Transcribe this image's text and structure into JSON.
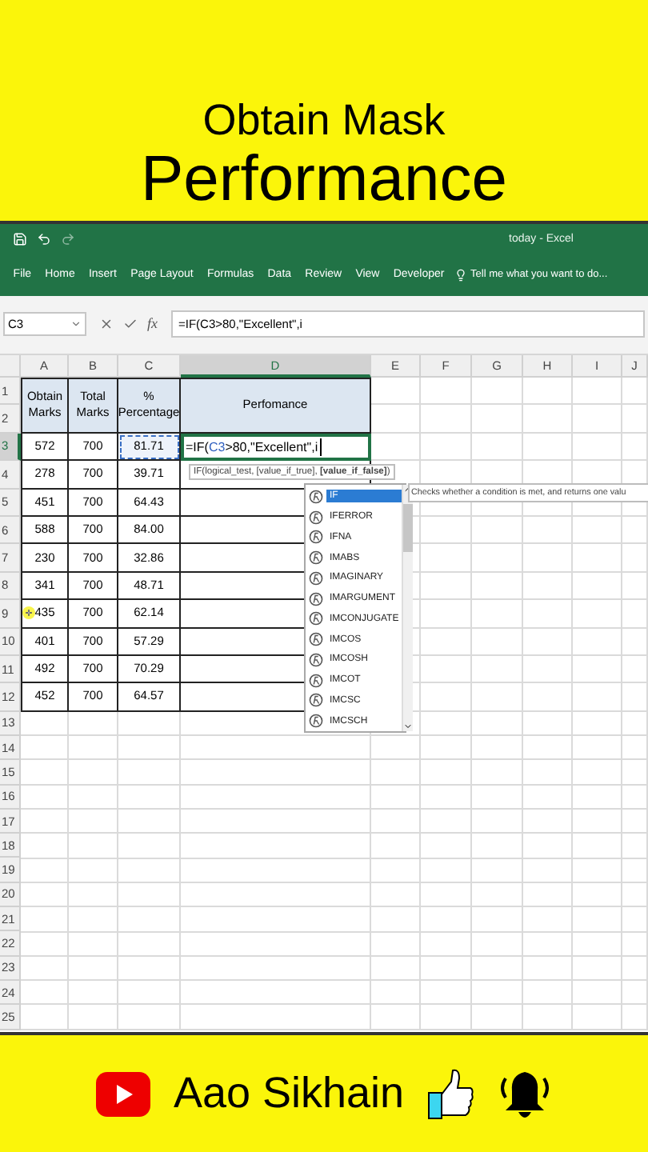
{
  "top_banner": {
    "title": "Obtain Mask",
    "subtitle": "Performance"
  },
  "excel": {
    "window_title": "today - Excel",
    "tabs": [
      {
        "label": "File",
        "selected": false
      },
      {
        "label": "Home",
        "selected": false
      },
      {
        "label": "Insert",
        "selected": false
      },
      {
        "label": "Page Layout",
        "selected": false
      },
      {
        "label": "Formulas",
        "selected": false
      },
      {
        "label": "Data",
        "selected": false
      },
      {
        "label": "Review",
        "selected": false
      },
      {
        "label": "View",
        "selected": false
      },
      {
        "label": "Developer",
        "selected": false
      }
    ],
    "tell_me": "Tell me what you want to do...",
    "name_box": "C3",
    "fx_label": "fx",
    "formula": "=IF(C3>80,\"Excellent\",i",
    "column_headers": [
      {
        "label": "A",
        "selected": false
      },
      {
        "label": "B",
        "selected": false
      },
      {
        "label": "C",
        "selected": false
      },
      {
        "label": "D",
        "selected": true
      },
      {
        "label": "E",
        "selected": false
      },
      {
        "label": "F",
        "selected": false
      },
      {
        "label": "G",
        "selected": false
      },
      {
        "label": "H",
        "selected": false
      },
      {
        "label": "I",
        "selected": false
      },
      {
        "label": "J",
        "selected": false
      }
    ],
    "row_numbers": [
      {
        "label": "1",
        "selected": false
      },
      {
        "label": "2",
        "selected": false
      },
      {
        "label": "3",
        "selected": true
      },
      {
        "label": "4",
        "selected": false
      },
      {
        "label": "5",
        "selected": false
      },
      {
        "label": "6",
        "selected": false
      },
      {
        "label": "7",
        "selected": false
      },
      {
        "label": "8",
        "selected": false
      },
      {
        "label": "9",
        "selected": false
      },
      {
        "label": "10",
        "selected": false
      },
      {
        "label": "11",
        "selected": false
      },
      {
        "label": "12",
        "selected": false
      },
      {
        "label": "13",
        "selected": false
      },
      {
        "label": "14",
        "selected": false
      },
      {
        "label": "15",
        "selected": false
      },
      {
        "label": "16",
        "selected": false
      },
      {
        "label": "17",
        "selected": false
      },
      {
        "label": "18",
        "selected": false
      },
      {
        "label": "19",
        "selected": false
      },
      {
        "label": "20",
        "selected": false
      },
      {
        "label": "21",
        "selected": false
      },
      {
        "label": "22",
        "selected": false
      },
      {
        "label": "23",
        "selected": false
      },
      {
        "label": "24",
        "selected": false
      },
      {
        "label": "25",
        "selected": false
      }
    ],
    "table_headers": [
      "Obtain Marks",
      "Total Marks",
      "% Percentage",
      "Perfomance"
    ],
    "table_rows": [
      [
        "572",
        "700",
        "81.71"
      ],
      [
        "278",
        "700",
        "39.71"
      ],
      [
        "451",
        "700",
        "64.43"
      ],
      [
        "588",
        "700",
        "84.00"
      ],
      [
        "230",
        "700",
        "32.86"
      ],
      [
        "341",
        "700",
        "48.71"
      ],
      [
        "435",
        "700",
        "62.14"
      ],
      [
        "401",
        "700",
        "57.29"
      ],
      [
        "492",
        "700",
        "70.29"
      ],
      [
        "452",
        "700",
        "64.57"
      ]
    ],
    "editing_cell": {
      "before": "=IF(",
      "reference": "C3",
      "after": ">80,\"Excellent\",i"
    },
    "argument_hint": "IF(logical_test, [value_if_true], **[value_if_false]**)",
    "autocomplete": [
      {
        "label": "IF",
        "selected": true
      },
      {
        "label": "IFERROR",
        "selected": false
      },
      {
        "label": "IFNA",
        "selected": false
      },
      {
        "label": "IMABS",
        "selected": false
      },
      {
        "label": "IMAGINARY",
        "selected": false
      },
      {
        "label": "IMARGUMENT",
        "selected": false
      },
      {
        "label": "IMCONJUGATE",
        "selected": false
      },
      {
        "label": "IMCOS",
        "selected": false
      },
      {
        "label": "IMCOSH",
        "selected": false
      },
      {
        "label": "IMCOT",
        "selected": false
      },
      {
        "label": "IMCSC",
        "selected": false
      },
      {
        "label": "IMCSCH",
        "selected": false
      }
    ],
    "function_description": "Checks whether a condition is met, and returns one valu"
  },
  "bottom_banner": {
    "channel": "Aao Sikhain"
  }
}
